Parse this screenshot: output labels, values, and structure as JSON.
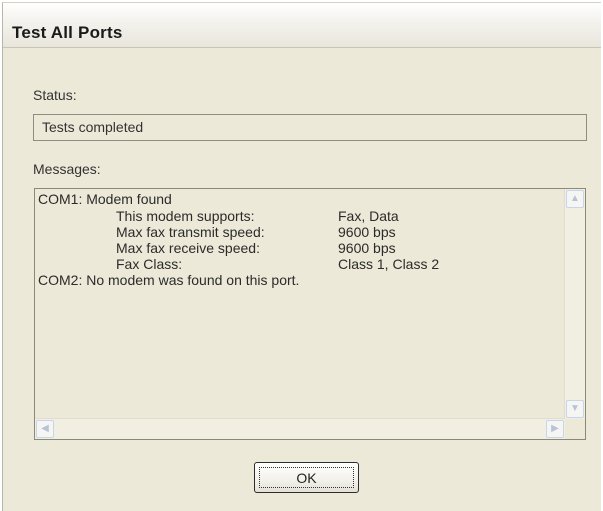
{
  "window": {
    "title": "Test All Ports"
  },
  "status": {
    "label": "Status:",
    "value": "Tests completed"
  },
  "messages": {
    "label": "Messages:",
    "lines": {
      "com1_header": "COM1:  Modem found",
      "supports_label": "This modem supports:",
      "supports_value": "Fax, Data",
      "transmit_label": "Max fax transmit speed:",
      "transmit_value": "9600 bps",
      "receive_label": "Max fax receive speed:",
      "receive_value": "9600 bps",
      "class_label": "Fax Class:",
      "class_value": "Class 1, Class 2",
      "com2_line": "COM2:  No modem was found on this port."
    }
  },
  "buttons": {
    "ok_label": "OK"
  },
  "icons": {
    "scroll_up": "scroll-up-arrow-icon",
    "scroll_down": "scroll-down-arrow-icon",
    "scroll_left": "scroll-left-arrow-icon",
    "scroll_right": "scroll-right-arrow-icon"
  },
  "colors": {
    "dialog_background": "#ece9d8",
    "field_border": "#8f8d80"
  }
}
